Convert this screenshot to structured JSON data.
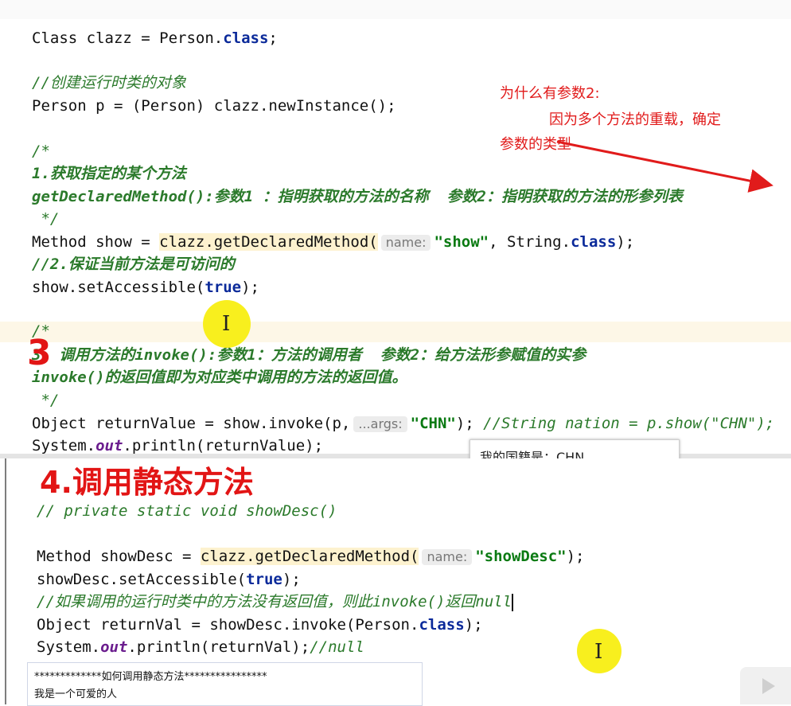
{
  "code_top": {
    "l1": {
      "a": "Class clazz = Person.",
      "b": "class",
      "c": ";"
    },
    "l2": "//创建运行时类的对象",
    "l3": "Person p = (Person) clazz.newInstance();",
    "l4": "/*",
    "l5": "1.获取指定的某个方法",
    "l6": "getDeclaredMethod():参数1 ：指明获取的方法的名称  参数2：指明获取的方法的形参列表",
    "l7": " */",
    "l8": {
      "a": "Method show = ",
      "b": "clazz.getDeclaredMethod(",
      "hint": "name:",
      "c": "\"show\"",
      "d": ", String.",
      "e": "class",
      "f": ");"
    },
    "l9": "//2.保证当前方法是可访问的",
    "l10": {
      "a": "show.setAccessible(",
      "b": "true",
      "c": ");"
    },
    "l11": "/*",
    "l12": "3. 调用方法的invoke():参数1：方法的调用者  参数2：给方法形参赋值的实参",
    "l13": "invoke()的返回值即为对应类中调用的方法的返回值。",
    "l14": " */",
    "l15": {
      "a": "Object returnValue = show.invoke(p,",
      "hint": "...args:",
      "c": "\"CHN\"",
      "d": "); ",
      "e": "//String nation = p.show(\"CHN\");"
    },
    "l16": {
      "a": "System.",
      "b": "out",
      "c": ".println(returnValue);"
    }
  },
  "console_top": "我的国籍是：CHN",
  "note": {
    "line1": "为什么有参数2:",
    "line2": "因为多个方法的重载，确定",
    "line3": "参数的类型"
  },
  "marker3": "3",
  "title4": "4.调用静态方法",
  "code_bottom": {
    "l1": "// private static void showDesc()",
    "l2": {
      "a": "Method showDesc = ",
      "b": "clazz.getDeclaredMethod(",
      "hint": "name:",
      "c": "\"showDesc\"",
      "d": ");"
    },
    "l3": {
      "a": "showDesc.setAccessible(",
      "b": "true",
      "c": ");"
    },
    "l4": "//如果调用的运行时类中的方法没有返回值，则此invoke()返回null",
    "l5": {
      "a": "Object returnVal = showDesc.invoke(Person.",
      "b": "class",
      "c": ");"
    },
    "l6": {
      "a": "System.",
      "b": "out",
      "c": ".println(returnVal);",
      "d": "//null"
    }
  },
  "console_bottom": {
    "line1": "*************如何调用静态方法****************",
    "line2": "我是一个可爱的人"
  },
  "colors": {
    "annotation": "#e11b1b",
    "cursor_highlight": "#f8ef1e",
    "keyword": "#0b2a9a",
    "comment": "#2b7a2b"
  }
}
